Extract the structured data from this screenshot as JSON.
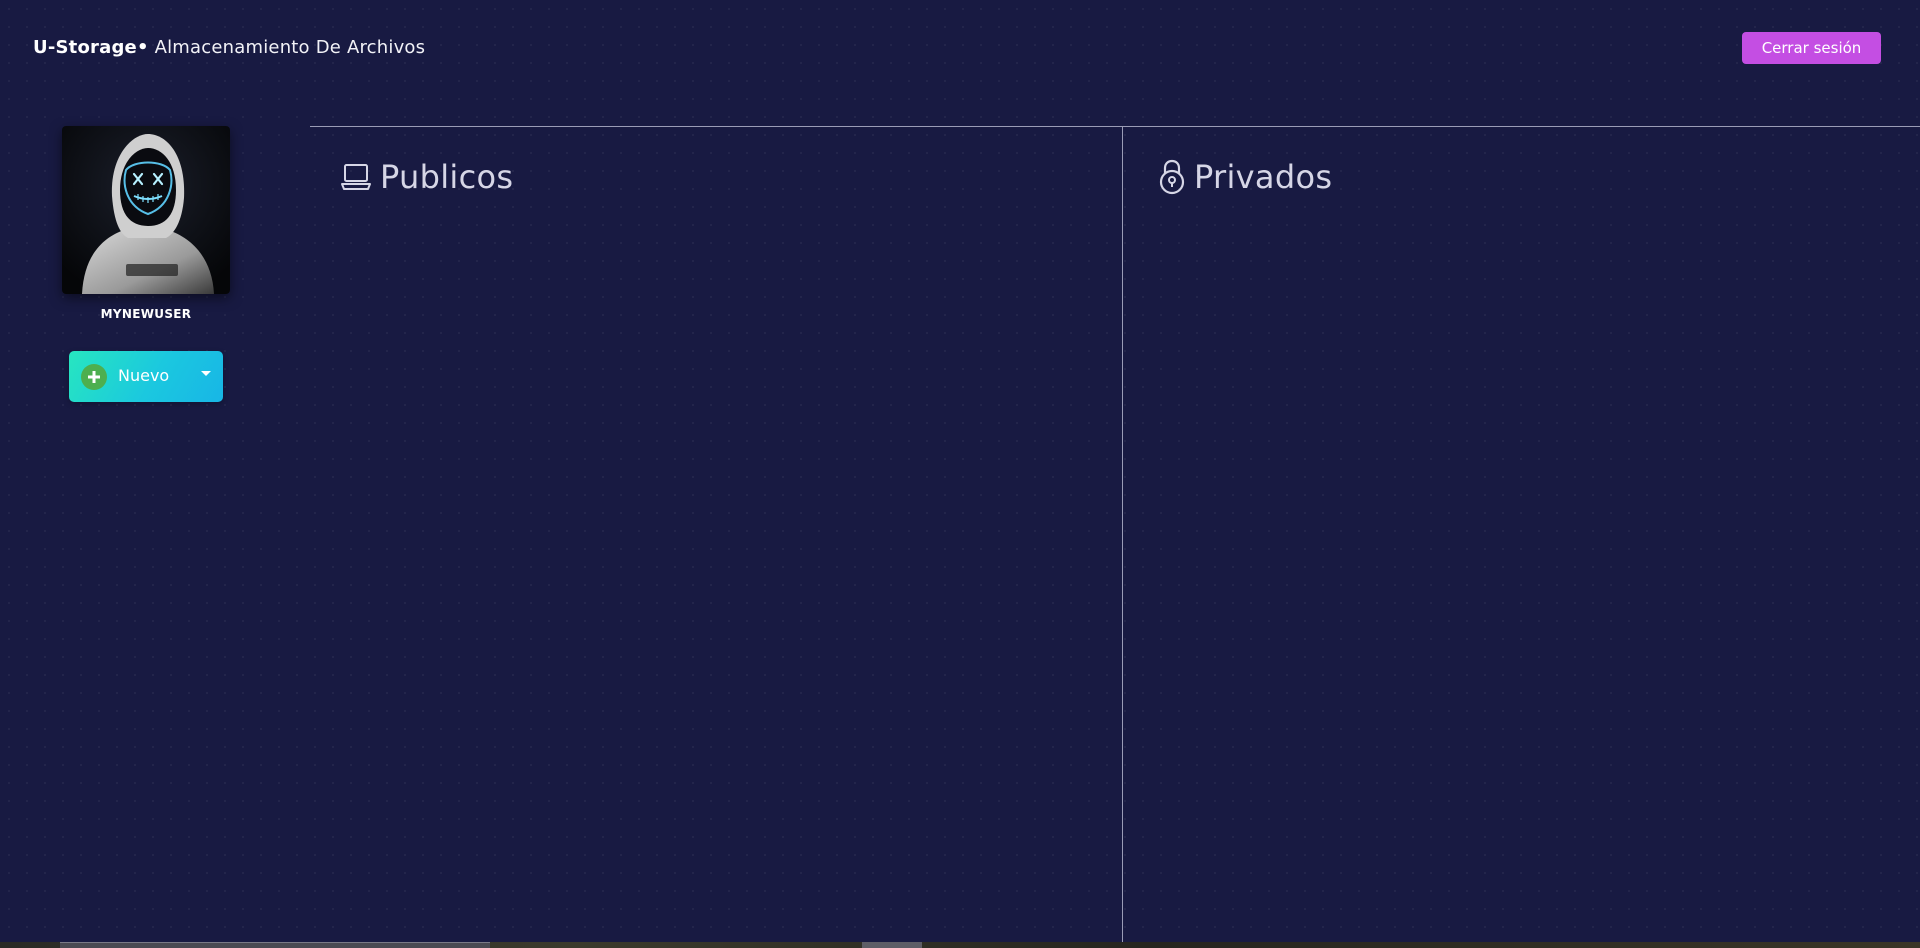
{
  "header": {
    "brand_name": "U-Storage",
    "brand_separator": "•",
    "brand_tagline": "Almacenamiento De Archivos",
    "logout_label": "Cerrar sesión"
  },
  "profile": {
    "username": "MYNEWUSER",
    "avatar_icon": "hooded-figure-led-mask-avatar"
  },
  "actions": {
    "new_label": "Nuevo",
    "new_icon": "plus-circle-icon",
    "dropdown_icon": "caret-down-icon"
  },
  "panels": {
    "public": {
      "title": "Publicos",
      "icon": "laptop-icon"
    },
    "private": {
      "title": "Privados",
      "icon": "padlock-icon"
    }
  },
  "colors": {
    "background": "#181a42",
    "logout_button": "#c44ee3",
    "new_button_gradient_start": "#27e6c0",
    "new_button_gradient_end": "#18b6e6",
    "plus_badge": "#4daf4f",
    "divider": "#9a9cb6"
  }
}
